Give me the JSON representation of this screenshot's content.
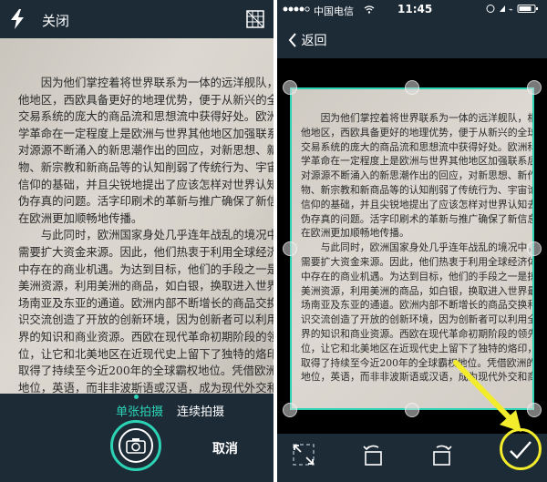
{
  "left_screen": {
    "top_bar": {
      "close_label": "关闭"
    },
    "document_text": [
      "　　因为他们掌控着将世界联系为一体的远洋舰队，相比其",
      "他地区，西欧具备更好的地理优势，便于从新兴的全球",
      "交易系统的庞大的商品流和思想流中获得好处。欧洲科",
      "学革命在一定程度上是欧洲与世界其他地区加强联系后，",
      "对源源不断涌入的新思潮作出的回应，对新思想、新作",
      "物、新宗教和新商品等的认知削弱了传统行为、宇宙论和",
      "信仰的基础，并且尖锐地提出了应该怎样对世界认知去",
      "伪存真的问题。活字印刷术的革新与推广确保了新信息",
      "在欧洲更加顺畅地传播。",
      "　　与此同时，欧洲国家身处几乎连年战乱的境况中，迫切",
      "需要扩大资金来源。因此，他们热衷于利用全球经济体系",
      "中存在的商业机遇。为达到目标，他们的手段之一是掠夺",
      "美洲资源，利用美洲的商品，如白银，换取进入世界最大市",
      "场南亚及东亚的通道。欧洲内部不断增长的商品交换和知",
      "识交流创造了开放的创新环境，因为创新者可以利用全世",
      "界的知识和商业资源。西欧在现代革命初期阶段的领先地",
      "位，让它和北美地区在近现代史上留下了独特的烙印，并",
      "取得了持续至今近200年的全球霸权地位。凭借欧洲的首要",
      "地位，英语，而非非波斯语或汉语，成为现代外交和商务"
    ],
    "modes": {
      "single": "单张拍摄",
      "continuous": "连续拍摄"
    },
    "cancel_label": "取消"
  },
  "right_screen": {
    "status_bar": {
      "carrier": "中国电信",
      "time": "11:45"
    },
    "nav": {
      "back_label": "返回"
    },
    "document_text": [
      "　　因为他们掌控着将世界联系为一体的远洋舰队，相比其",
      "他地区，西欧具备更好的地理优势，便于从新兴的全球",
      "交易系统的庞大的商品流和思想流中获得好处。欧洲科",
      "学革命在一定程度上是欧洲与世界其他地区加强联系后，",
      "对源源不断涌入的新思潮作出的回应，对新思想、新作",
      "物、新宗教和新商品等的认知削弱了传统行为、宇宙论和",
      "信仰的基础，并且尖锐地提出了应该怎样对世界认知去",
      "伪存真的问题。活字印刷术的革新与推广确保了新信息",
      "在欧洲更加顺畅地传播。",
      "　　与此同时，欧洲国家身处几乎连年战乱的境况中，迫切",
      "需要扩大资金来源。因此，他们热衷于利用全球经济体系",
      "中存在的商业机遇。为达到目标，他们的手段之一是掠夺",
      "美洲资源，利用美洲的商品，如白银，换取进入世界最大市",
      "场南亚及东亚的通道。欧洲内部不断增长的商品交换和知",
      "识交流创造了开放的创新环境，因为创新者可以利用全世",
      "界的知识和商业资源。西欧在现代革命初期阶段的领先地",
      "位，让它和北美地区在近现代史上留下了独特的烙印，并",
      "取得了持续至今近200年的全球霸权地位。凭借欧洲的首要",
      "地位，英语，而非非波斯语或汉语，成为现代外交和商务"
    ]
  },
  "colors": {
    "background": "#1d2b37",
    "accent": "#2bd3b4",
    "highlight": "#f2ec2c"
  },
  "icons": [
    "flash-icon",
    "grid-icon",
    "camera-icon",
    "wifi-icon",
    "battery-icon",
    "back-chevron-icon",
    "fullscreen-icon",
    "rotate-left-icon",
    "rotate-right-icon",
    "check-icon"
  ]
}
